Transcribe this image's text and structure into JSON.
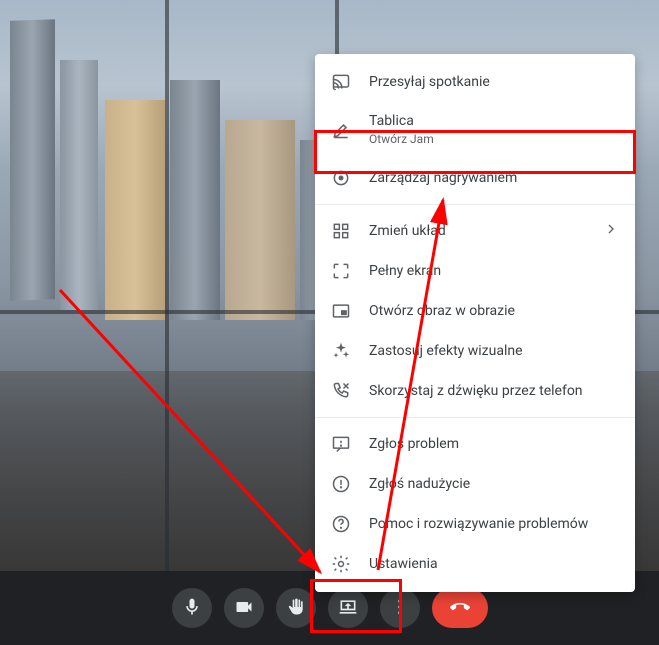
{
  "menu": {
    "items": [
      {
        "label": "Przesyłaj spotkanie",
        "icon": "cast-icon"
      },
      {
        "label": "Tablica",
        "sub": "Otwórz Jam",
        "icon": "pen-icon"
      },
      {
        "label": "Zarządzaj nagrywaniem",
        "icon": "record-icon",
        "highlighted": true
      }
    ],
    "items2": [
      {
        "label": "Zmień układ",
        "icon": "layout-icon",
        "chevron": true
      },
      {
        "label": "Pełny ekran",
        "icon": "fullscreen-icon"
      },
      {
        "label": "Otwórz obraz w obrazie",
        "icon": "pip-icon"
      },
      {
        "label": "Zastosuj efekty wizualne",
        "icon": "sparkle-icon"
      },
      {
        "label": "Skorzystaj z dźwięku przez telefon",
        "icon": "phone-audio-icon"
      }
    ],
    "items3": [
      {
        "label": "Zgłoś problem",
        "icon": "feedback-icon"
      },
      {
        "label": "Zgłoś nadużycie",
        "icon": "alert-icon"
      },
      {
        "label": "Pomoc i rozwiązywanie problemów",
        "icon": "help-icon"
      },
      {
        "label": "Ustawienia",
        "icon": "gear-icon"
      }
    ]
  },
  "controls": {
    "mic": "mic-button",
    "camera": "camera-button",
    "hand": "raise-hand-button",
    "present": "present-button",
    "more": "more-options-button",
    "end": "end-call-button"
  },
  "colors": {
    "highlight": "#ff0000",
    "endcall": "#ea4335"
  }
}
